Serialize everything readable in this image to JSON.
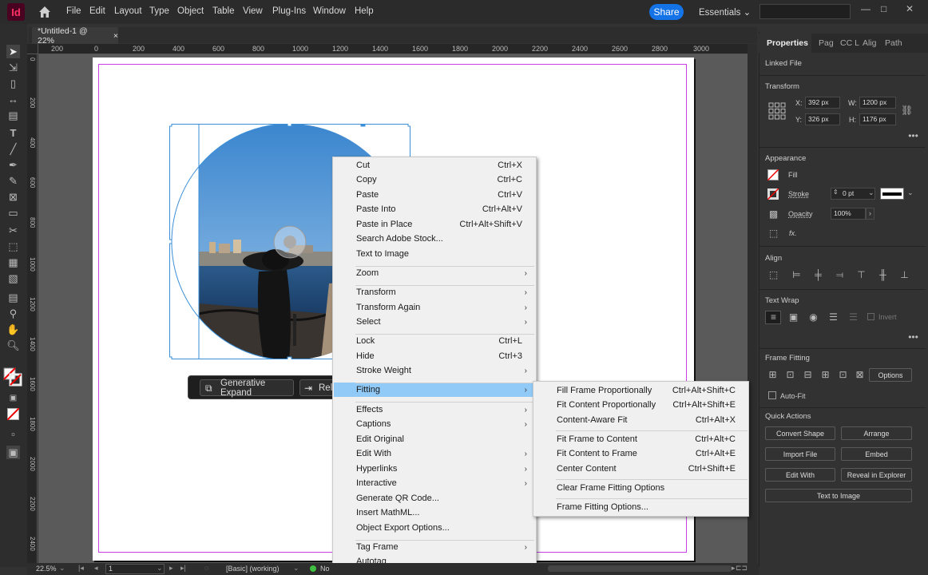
{
  "app": {
    "logo": "Id",
    "share": "Share",
    "workspace": "Essentials"
  },
  "menu": [
    "File",
    "Edit",
    "Layout",
    "Type",
    "Object",
    "Table",
    "View",
    "Plug-Ins",
    "Window",
    "Help"
  ],
  "window_controls": [
    "—",
    "□",
    "✕"
  ],
  "document": {
    "tab_title": "*Untitled-1 @ 22%",
    "tab_close": "×"
  },
  "ruler": {
    "h_labels": [
      "200",
      "0",
      "200",
      "400",
      "600",
      "800",
      "1000",
      "1200",
      "1400",
      "1600",
      "1800",
      "2000",
      "2200",
      "2400",
      "2600",
      "2800",
      "3000"
    ],
    "v_labels": [
      "0",
      "200",
      "400",
      "600",
      "800",
      "1000",
      "1200",
      "1400",
      "1600",
      "1800",
      "2000",
      "2200",
      "2400",
      "2600",
      "2800",
      "3000"
    ]
  },
  "context_bar": {
    "generative_expand": "Generative Expand",
    "second_button": "Rel"
  },
  "context_menu": [
    {
      "label": "Cut",
      "shortcut": "Ctrl+X"
    },
    {
      "label": "Copy",
      "shortcut": "Ctrl+C"
    },
    {
      "label": "Paste",
      "shortcut": "Ctrl+V"
    },
    {
      "label": "Paste Into",
      "shortcut": "Ctrl+Alt+V"
    },
    {
      "label": "Paste in Place",
      "shortcut": "Ctrl+Alt+Shift+V"
    },
    {
      "label": "Search Adobe Stock...",
      "shortcut": ""
    },
    {
      "label": "Text to Image",
      "shortcut": ""
    },
    {
      "label": "Zoom",
      "shortcut": "",
      "submenu": true
    },
    {
      "label": "Transform",
      "shortcut": "",
      "submenu": true
    },
    {
      "label": "Transform Again",
      "shortcut": "",
      "submenu": true
    },
    {
      "label": "Select",
      "shortcut": "",
      "submenu": true
    },
    {
      "label": "Lock",
      "shortcut": "Ctrl+L"
    },
    {
      "label": "Hide",
      "shortcut": "Ctrl+3"
    },
    {
      "label": "Stroke Weight",
      "shortcut": "",
      "submenu": true
    },
    {
      "label": "Fitting",
      "shortcut": "",
      "submenu": true,
      "highlighted": true
    },
    {
      "label": "Effects",
      "shortcut": "",
      "submenu": true
    },
    {
      "label": "Captions",
      "shortcut": "",
      "submenu": true
    },
    {
      "label": "Edit Original",
      "shortcut": ""
    },
    {
      "label": "Edit With",
      "shortcut": "",
      "submenu": true
    },
    {
      "label": "Hyperlinks",
      "shortcut": "",
      "submenu": true
    },
    {
      "label": "Interactive",
      "shortcut": "",
      "submenu": true
    },
    {
      "label": "Generate QR Code...",
      "shortcut": ""
    },
    {
      "label": "Insert MathML...",
      "shortcut": ""
    },
    {
      "label": "Object Export Options...",
      "shortcut": ""
    },
    {
      "label": "Tag Frame",
      "shortcut": "",
      "submenu": true
    },
    {
      "label": "Autotag",
      "shortcut": ""
    }
  ],
  "fitting_submenu": [
    {
      "label": "Fill Frame Proportionally",
      "shortcut": "Ctrl+Alt+Shift+C"
    },
    {
      "label": "Fit Content Proportionally",
      "shortcut": "Ctrl+Alt+Shift+E"
    },
    {
      "label": "Content-Aware Fit",
      "shortcut": "Ctrl+Alt+X"
    },
    {
      "label": "Fit Frame to Content",
      "shortcut": "Ctrl+Alt+C"
    },
    {
      "label": "Fit Content to Frame",
      "shortcut": "Ctrl+Alt+E"
    },
    {
      "label": "Center Content",
      "shortcut": "Ctrl+Shift+E"
    },
    {
      "label": "Clear Frame Fitting Options",
      "shortcut": ""
    },
    {
      "label": "Frame Fitting Options...",
      "shortcut": ""
    }
  ],
  "panel": {
    "tabs": [
      "Properties",
      "Pag",
      "CC L",
      "Alig",
      "Path"
    ],
    "linked_file": "Linked File",
    "transform": {
      "title": "Transform",
      "x_label": "X:",
      "x": "392 px",
      "y_label": "Y:",
      "y": "326 px",
      "w_label": "W:",
      "w": "1200 px",
      "h_label": "H:",
      "h": "1176 px"
    },
    "appearance": {
      "title": "Appearance",
      "fill": "Fill",
      "stroke": "Stroke",
      "stroke_weight": "0 pt",
      "opacity": "Opacity",
      "opacity_value": "100%",
      "fx": "fx."
    },
    "align": {
      "title": "Align"
    },
    "text_wrap": {
      "title": "Text Wrap",
      "invert": "Invert"
    },
    "frame_fitting": {
      "title": "Frame Fitting",
      "options": "Options",
      "auto_fit": "Auto-Fit"
    },
    "quick_actions": {
      "title": "Quick Actions",
      "convert_shape": "Convert Shape",
      "arrange": "Arrange",
      "import_file": "Import File",
      "embed": "Embed",
      "edit_with": "Edit With",
      "reveal": "Reveal in Explorer",
      "text_to_image": "Text to Image"
    }
  },
  "status": {
    "zoom": "22.5%",
    "page": "1",
    "style": "[Basic] (working)",
    "errors": "No"
  }
}
